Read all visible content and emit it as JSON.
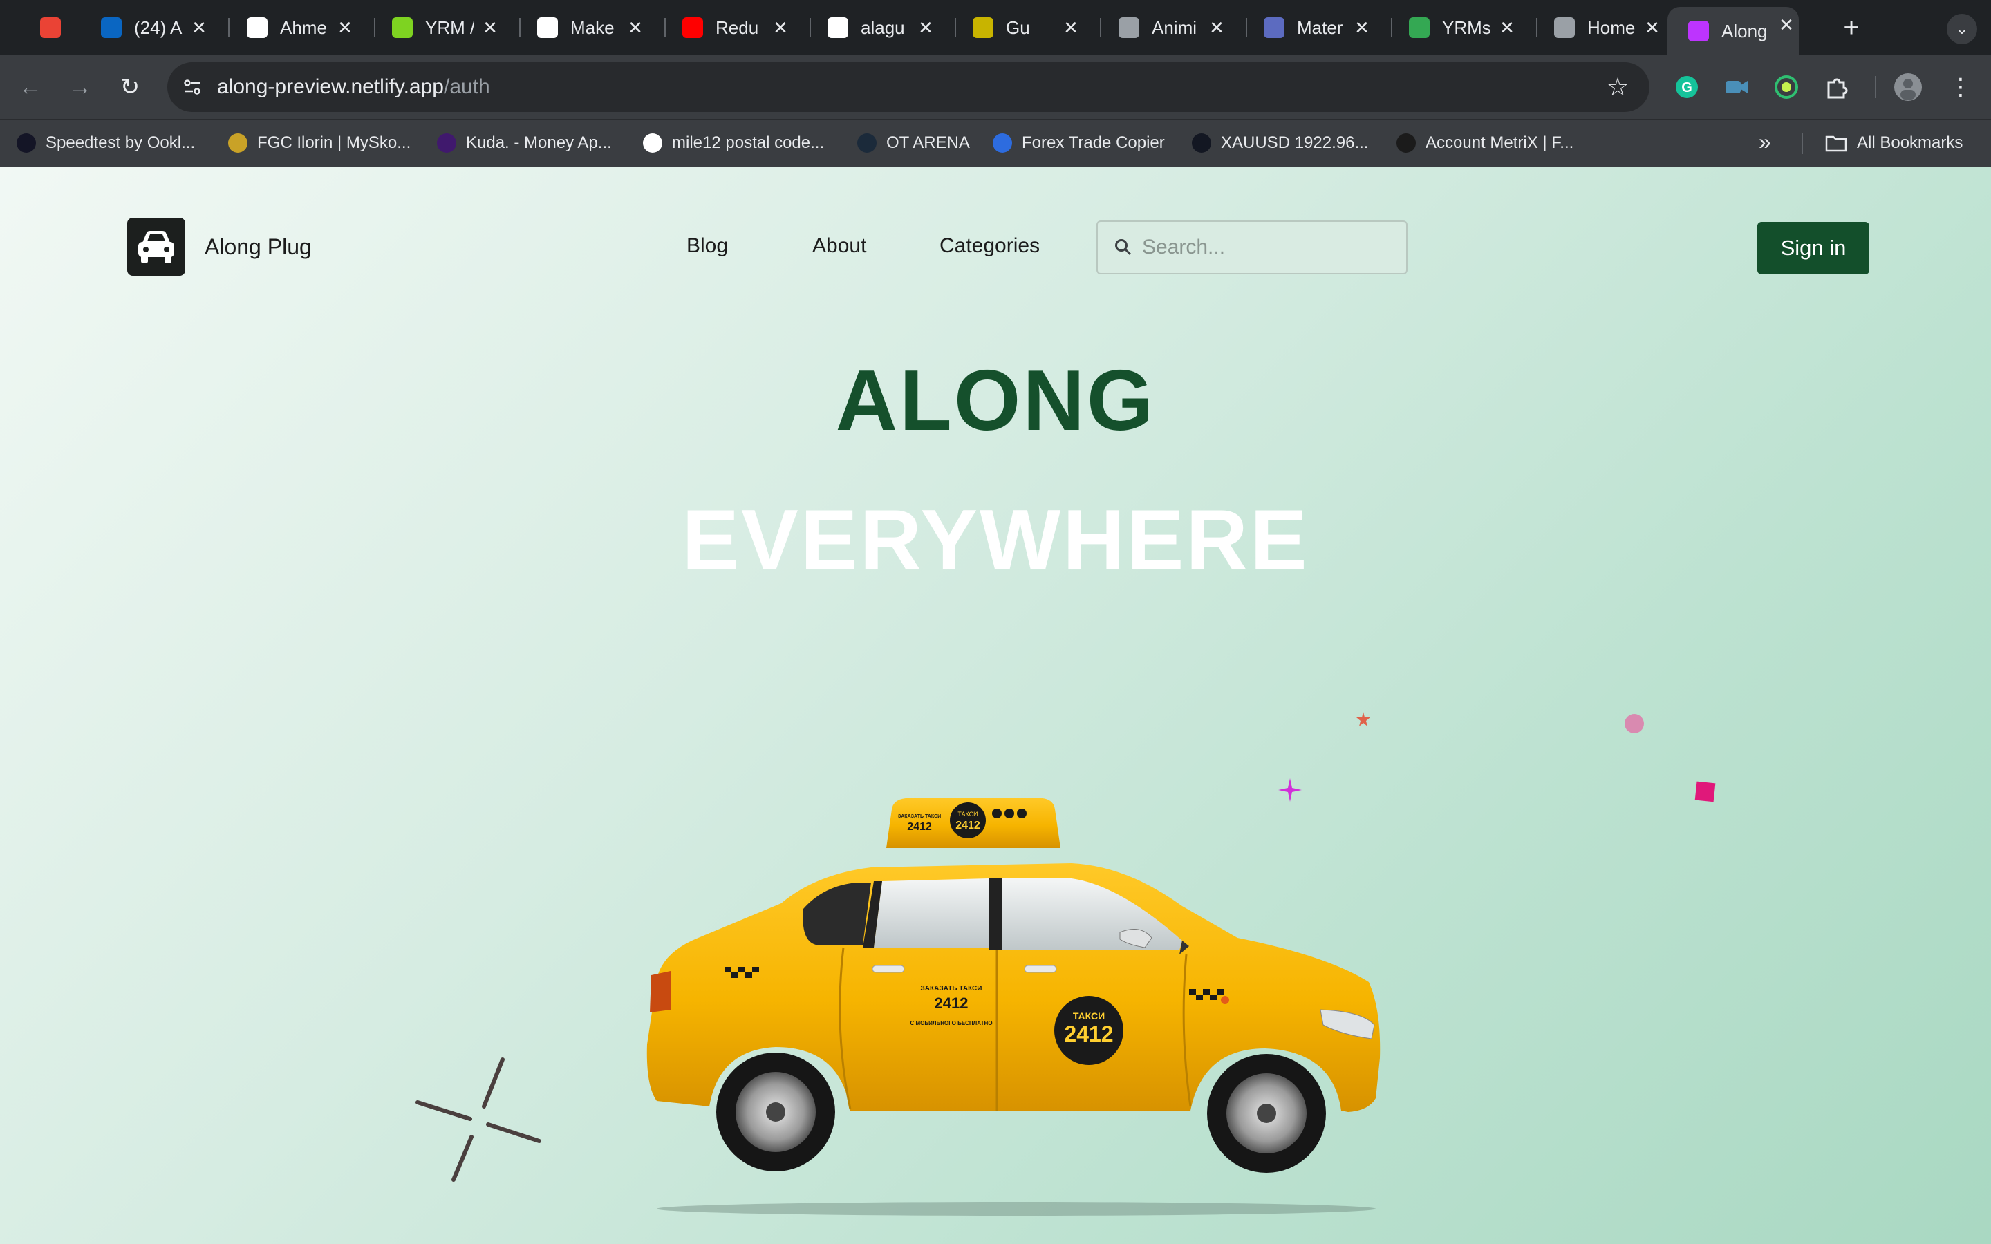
{
  "browser": {
    "tabs": [
      {
        "title": "",
        "icon": "gmail-icon",
        "color": "#ea4335"
      },
      {
        "title": "(24) A",
        "icon": "linkedin-icon",
        "color": "#0a66c2"
      },
      {
        "title": "Ahme",
        "icon": "github-icon",
        "color": "#ffffff"
      },
      {
        "title": "YRM /",
        "icon": "yrm-icon",
        "color": "#7ed321"
      },
      {
        "title": "Make",
        "icon": "openai-icon",
        "color": "#ffffff"
      },
      {
        "title": "Redu",
        "icon": "youtube-icon",
        "color": "#ff0000"
      },
      {
        "title": "alagu",
        "icon": "github-icon",
        "color": "#ffffff"
      },
      {
        "title": "Gu",
        "icon": "gmass-icon",
        "color": "#c8b400"
      },
      {
        "title": "Animi",
        "icon": "globe-icon",
        "color": "#9aa0a6"
      },
      {
        "title": "Mater",
        "icon": "material-icon",
        "color": "#5c6bc0"
      },
      {
        "title": "YRMs",
        "icon": "sheets-icon",
        "color": "#34a853"
      },
      {
        "title": "Home",
        "icon": "globe-icon",
        "color": "#9aa0a6"
      },
      {
        "title": "Along",
        "icon": "vite-icon",
        "color": "#bd34fe",
        "active": true
      }
    ],
    "new_tab_label": "+",
    "url_host": "along-preview.netlify.app",
    "url_path": "/auth",
    "bookmarks": [
      {
        "label": "Speedtest by Ookl...",
        "icon": "speedtest-icon",
        "color": "#141526"
      },
      {
        "label": "FGC Ilorin | MySko...",
        "icon": "school-icon",
        "color": "#c9a227"
      },
      {
        "label": "Kuda. - Money Ap...",
        "icon": "kuda-icon",
        "color": "#40196d"
      },
      {
        "label": "mile12 postal code...",
        "icon": "google-icon",
        "color": "#ffffff"
      },
      {
        "label": "OT ARENA",
        "icon": "otarena-icon",
        "color": "#1b2a3a"
      },
      {
        "label": "Forex Trade Copier",
        "icon": "forex-icon",
        "color": "#2d6cdf"
      },
      {
        "label": "XAUUSD 1922.96...",
        "icon": "tradingview-icon",
        "color": "#131722"
      },
      {
        "label": "Account MetriX | F...",
        "icon": "metrix-icon",
        "color": "#1b1b1b"
      }
    ],
    "all_bookmarks_label": "All Bookmarks"
  },
  "page": {
    "brand": "Along Plug",
    "nav": [
      "Blog",
      "About",
      "Categories"
    ],
    "search_placeholder": "Search...",
    "signin_label": "Sign in",
    "hero_line1": "ALONG",
    "hero_line2": "EVERYWHERE",
    "taxi": {
      "roof_text": "ТАКСИ",
      "number": "2412",
      "door_text": "ЗАКАЗАТЬ ТАКСИ",
      "door_sub": "С МОБИЛЬНОГО БЕСПЛАТНО"
    },
    "colors": {
      "brand_green": "#15502c",
      "button_green": "#134f2b",
      "taxi_yellow": "#f6b800"
    }
  }
}
